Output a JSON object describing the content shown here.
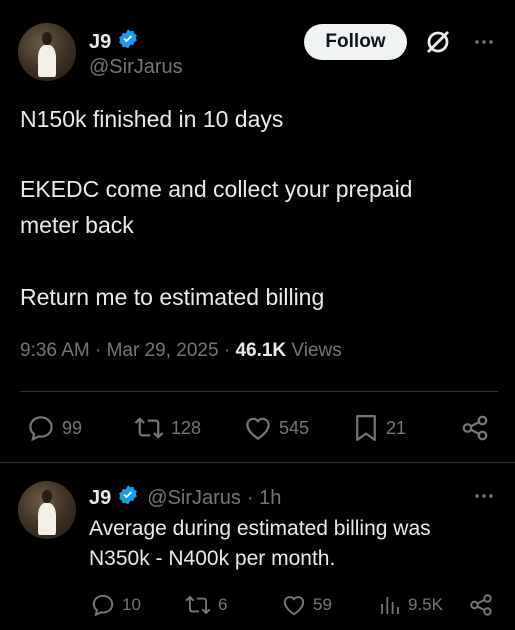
{
  "tweet": {
    "author_name": "J9",
    "author_handle": "@SirJarus",
    "follow_label": "Follow",
    "lines": [
      "N150k finished in 10 days",
      "EKEDC come and collect your prepaid",
      "meter back",
      "Return me to estimated billing"
    ],
    "time": "9:36 AM · Mar 29, 2025 · ",
    "views_count": "46.1K",
    "views_label": " Views",
    "stats": {
      "replies": "99",
      "reposts": "128",
      "likes": "545",
      "bookmarks": "21"
    }
  },
  "reply": {
    "author_name": "J9",
    "author_handle": "@SirJarus",
    "time": "· 1h",
    "lines": [
      "Average during estimated billing was",
      "N350k - N400k per month."
    ],
    "stats": {
      "replies": "10",
      "reposts": "6",
      "likes": "59",
      "views": "9.5K"
    }
  },
  "colors": {
    "background": "#000000",
    "text": "#e7e9ea",
    "muted": "#71767b",
    "verified": "#1d9bf0"
  }
}
